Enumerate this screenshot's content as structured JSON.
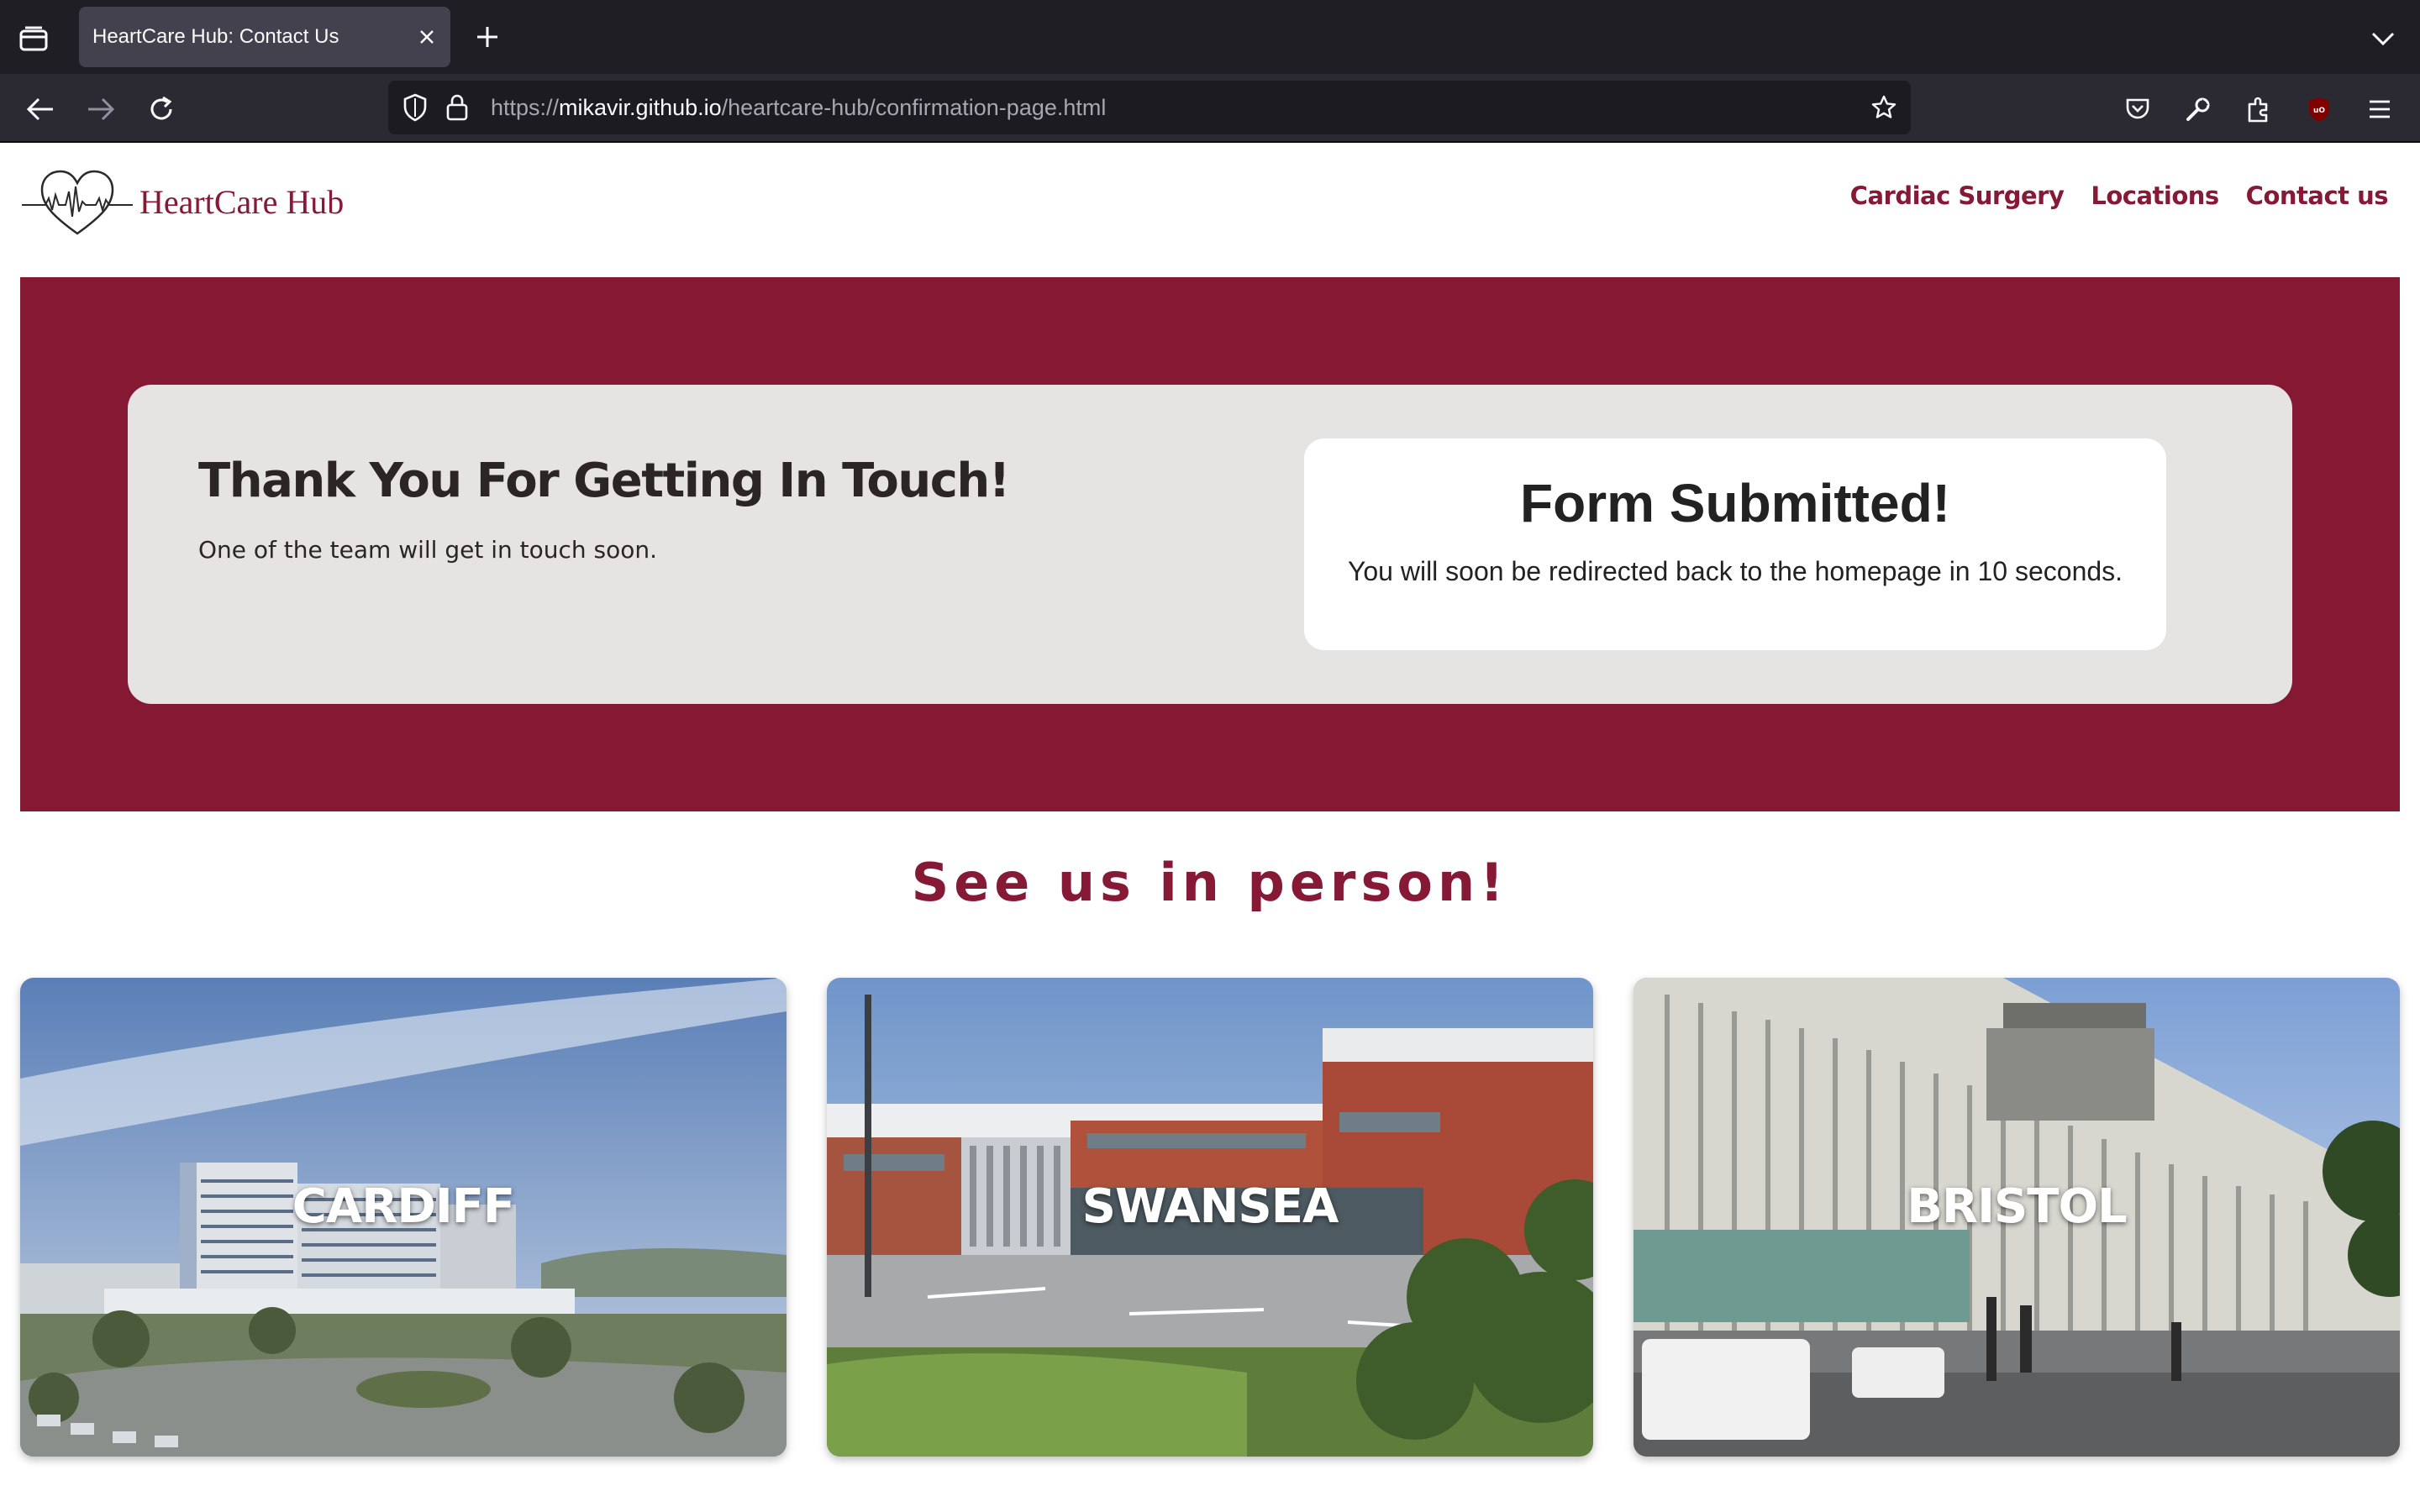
{
  "browser": {
    "tab_title": "HeartCare Hub: Contact Us",
    "url_scheme": "https://",
    "url_host": "mikavir.github.io",
    "url_path": "/heartcare-hub/confirmation-page.html"
  },
  "site": {
    "logo_text": "HeartCare Hub",
    "nav": [
      "Cardiac Surgery",
      "Locations",
      "Contact us"
    ],
    "accent_color": "#861935"
  },
  "hero": {
    "title": "Thank You For Getting In Touch!",
    "subtitle": "One of the team will get in touch soon.",
    "form_title": "Form Submitted!",
    "form_text": "You will soon be redirected back to the homepage in 10 seconds."
  },
  "locations": {
    "heading": "See us in person!",
    "cards": [
      "CARDIFF",
      "SWANSEA",
      "BRISTOL"
    ]
  }
}
